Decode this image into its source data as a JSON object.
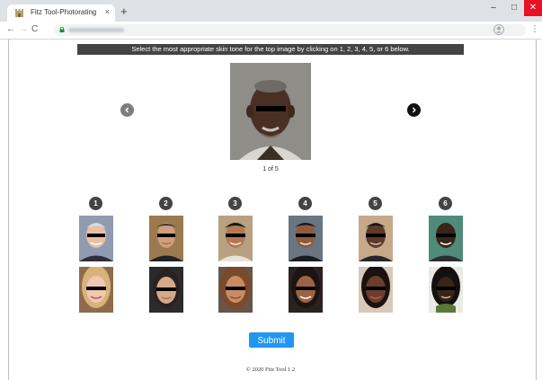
{
  "browser": {
    "tab_title": "Fitz Tool-Photorating",
    "tab_close": "×",
    "new_tab": "+",
    "minimize": "–",
    "maximize": "□",
    "close": "✕",
    "back": "←",
    "forward": "→",
    "reload": "C",
    "menu": "⋮"
  },
  "page": {
    "instruction": "Select the most appropriate skin tone for the top image by clicking on 1, 2, 3, 4, 5, or 6 below.",
    "counter": "1 of 5",
    "submit_label": "Submit",
    "footer": "© 2020 Fitz Tool 1.2"
  },
  "options": [
    {
      "number": "1"
    },
    {
      "number": "2"
    },
    {
      "number": "3"
    },
    {
      "number": "4"
    },
    {
      "number": "5"
    },
    {
      "number": "6"
    }
  ],
  "colors": {
    "instruction_bar": "#444444",
    "submit": "#2196f3",
    "window_close": "#e81123",
    "option_badge": "#444444"
  },
  "icons": {
    "prev": "chevron-left-icon",
    "next": "chevron-right-icon",
    "lock": "lock-icon",
    "profile": "profile-icon",
    "favicon": "castle-icon"
  }
}
